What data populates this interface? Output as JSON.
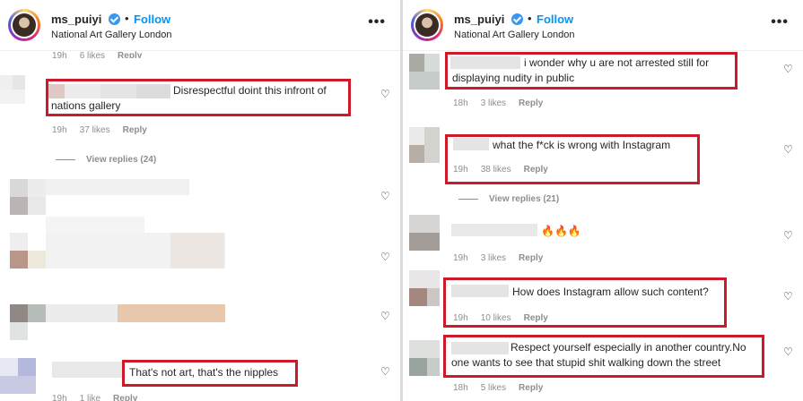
{
  "post": {
    "username": "ms_puiyi",
    "follow_label": "Follow",
    "separator": "•",
    "location": "National Art Gallery London",
    "more_label": "•••",
    "heart_icon": "heart-outline-icon"
  },
  "left_panel": {
    "top_meta": [
      "19h",
      "6 likes",
      "Reply"
    ],
    "comment1": {
      "text": "Disrespectful doint this infront of nations gallery",
      "time": "19h",
      "likes": "37 likes",
      "reply": "Reply"
    },
    "view_replies": "View replies (24)",
    "comment_last": {
      "text": "That's not art, that's the nipples",
      "time": "19h",
      "likes": "1 like",
      "reply": "Reply"
    }
  },
  "right_panel": {
    "comment1": {
      "text": "i wonder why u are not arrested still for displaying nudity in public",
      "time": "18h",
      "likes": "3 likes",
      "reply": "Reply"
    },
    "comment2": {
      "text": "what the f*ck is wrong with Instagram",
      "time": "19h",
      "likes": "38 likes",
      "reply": "Reply"
    },
    "view_replies": "View replies (21)",
    "comment3": {
      "text": "🔥🔥🔥",
      "time": "19h",
      "likes": "3 likes",
      "reply": "Reply"
    },
    "comment4": {
      "text": "How does Instagram allow such content?",
      "time": "19h",
      "likes": "10 likes",
      "reply": "Reply"
    },
    "comment5": {
      "text": "Respect yourself especially in another country.No one wants to see that stupid shit walking down the street",
      "time": "18h",
      "likes": "5 likes",
      "reply": "Reply"
    }
  },
  "colors": {
    "highlight_box": "#cc1a2a",
    "follow": "#0095f6",
    "verified": "#3897f0"
  }
}
